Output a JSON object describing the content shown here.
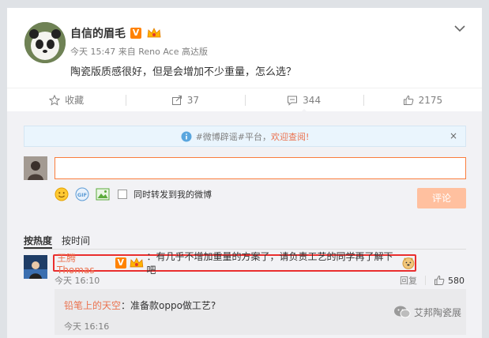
{
  "post": {
    "author": "自信的眉毛",
    "v_badge": "V",
    "time": "今天 15:47",
    "source_prefix": "来自",
    "source": "Reno Ace 高达版",
    "text": "陶瓷版质感很好，但是会增加不少重量，怎么选？"
  },
  "actions": {
    "favorite_label": "收藏",
    "forward_count": "37",
    "comment_count": "344",
    "like_count": "2175"
  },
  "notice": {
    "tag": "#微博辟谣#平台，",
    "link": "欢迎查阅!",
    "close": "×"
  },
  "composer": {
    "input_value": "",
    "forward_label": "同时转发到我的微博",
    "submit_label": "评论"
  },
  "sort": {
    "hot_label": "按热度",
    "time_label": "按时间"
  },
  "comment": {
    "user": "王腾Thomas",
    "v_badge": "V",
    "text": "：有几乎不增加重量的方案了，请负责工艺的同学再了解下吧",
    "time": "今天 16:10",
    "reply_label": "回复",
    "like_count": "580"
  },
  "reply": {
    "user": "铅笔上的天空",
    "text": "：准备款oppo做工艺?",
    "time": "今天 16:16"
  },
  "watermark": {
    "text": "艾邦陶瓷展"
  },
  "colors": {
    "accent_orange": "#eb7350",
    "highlight_red": "#ea2e2e",
    "v_badge": "#ff8200"
  }
}
